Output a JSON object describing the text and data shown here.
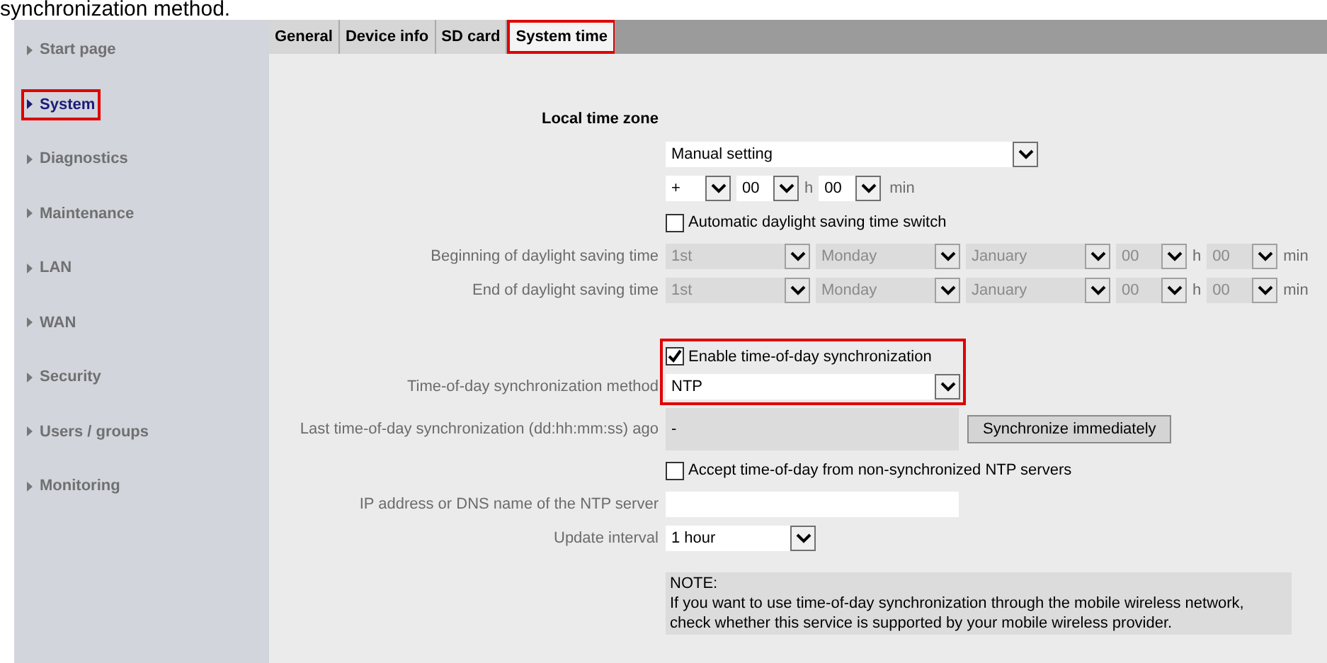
{
  "caption": "synchronization method.",
  "tabs": [
    {
      "label": "General",
      "selected": false,
      "highlighted": false
    },
    {
      "label": "Device info",
      "selected": false,
      "highlighted": false
    },
    {
      "label": "SD card",
      "selected": false,
      "highlighted": false
    },
    {
      "label": "System time",
      "selected": true,
      "highlighted": true
    }
  ],
  "sidebar": {
    "items": [
      {
        "label": "Start page",
        "selected": false,
        "highlighted": false
      },
      {
        "label": "System",
        "selected": true,
        "highlighted": true
      },
      {
        "label": "Diagnostics",
        "selected": false,
        "highlighted": false
      },
      {
        "label": "Maintenance",
        "selected": false,
        "highlighted": false
      },
      {
        "label": "LAN",
        "selected": false,
        "highlighted": false
      },
      {
        "label": "WAN",
        "selected": false,
        "highlighted": false
      },
      {
        "label": "Security",
        "selected": false,
        "highlighted": false
      },
      {
        "label": "Users / groups",
        "selected": false,
        "highlighted": false
      },
      {
        "label": "Monitoring",
        "selected": false,
        "highlighted": false
      }
    ]
  },
  "form": [
    {
      "kind": "heading",
      "label": "Local time zone"
    },
    {
      "kind": "mode_select",
      "value": "Manual setting"
    },
    {
      "kind": "offset",
      "sign": "+",
      "hours": "00",
      "hours_unit": "h",
      "minutes": "00",
      "minutes_unit": "min"
    },
    {
      "kind": "checkbox",
      "label": "Automatic daylight saving time switch",
      "checked": false
    },
    {
      "kind": "daylight",
      "label": "Beginning of daylight saving time",
      "disabled": true,
      "fields": [
        {
          "value": "1st"
        },
        {
          "value": "Monday"
        },
        {
          "value": "January"
        },
        {
          "value": "00",
          "unit": "h"
        },
        {
          "value": "00",
          "unit": "min"
        }
      ]
    },
    {
      "kind": "daylight",
      "label": "End of daylight saving time",
      "disabled": true,
      "fields": [
        {
          "value": "1st"
        },
        {
          "value": "Monday"
        },
        {
          "value": "January"
        },
        {
          "value": "00",
          "unit": "h"
        },
        {
          "value": "00",
          "unit": "min"
        }
      ]
    },
    {
      "kind": "spacer"
    },
    {
      "kind": "group",
      "highlighted": true,
      "rows": [
        {
          "kind": "checkbox",
          "label": "Enable time-of-day synchronization",
          "checked": true
        },
        {
          "kind": "method_select",
          "label": "Time-of-day synchronization method",
          "value": "NTP"
        }
      ]
    },
    {
      "kind": "status",
      "label": "Last time-of-day synchronization (dd:hh:mm:ss) ago",
      "value": "-",
      "button": "Synchronize immediately"
    },
    {
      "kind": "checkbox",
      "label": "Accept time-of-day from non-synchronized NTP servers",
      "checked": false
    },
    {
      "kind": "text_input",
      "label": "IP address or DNS name of the NTP server"
    },
    {
      "kind": "interval_select",
      "label": "Update interval",
      "value": "1 hour"
    },
    {
      "kind": "gap"
    },
    {
      "kind": "note",
      "title": "NOTE:",
      "text": "If you want to use time-of-day synchronization through the mobile wireless network, check whether this service is supported by your mobile wireless provider."
    }
  ]
}
